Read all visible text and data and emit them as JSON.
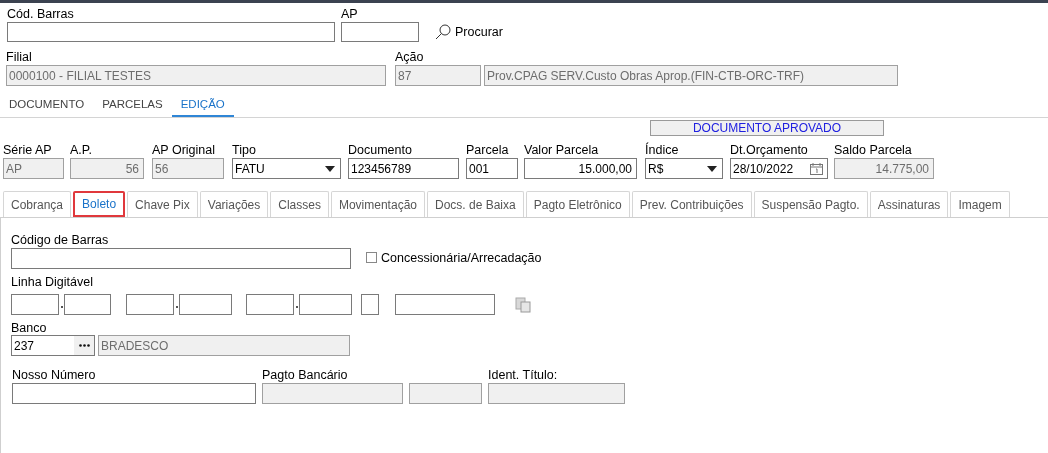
{
  "search": {
    "fields": [
      {
        "label": "Cód. Barras"
      },
      {
        "label": "AP"
      }
    ],
    "button": "Procurar"
  },
  "header": {
    "fields": [
      {
        "label": "Filial",
        "kind": "readonly",
        "value": "0000100 - FILIAL TESTES"
      },
      {
        "label": "Ação",
        "kind": "readonly",
        "value": "87"
      },
      {
        "kind": "readonly",
        "value": "Prov.CPAG SERV.Custo Obras Aprop.(FIN-CTB-ORC-TRF)"
      }
    ]
  },
  "main_tabs": [
    {
      "label": "DOCUMENTO",
      "selected": false
    },
    {
      "label": "PARCELAS",
      "selected": false
    },
    {
      "label": "EDIÇÃO",
      "selected": true
    }
  ],
  "status": "DOCUMENTO APROVADO",
  "fields": [
    {
      "label": "Série AP",
      "kind": "readonly",
      "value": "AP"
    },
    {
      "label": "A.P.",
      "kind": "readonly-amount",
      "value": "56"
    },
    {
      "label": "AP Original",
      "kind": "readonly",
      "value": "56"
    },
    {
      "label": "Tipo",
      "kind": "select",
      "value": "FATU"
    },
    {
      "label": "Documento",
      "kind": "text",
      "value": "123456789"
    },
    {
      "label": "Parcela",
      "kind": "text",
      "value": "001"
    },
    {
      "label": "Valor Parcela",
      "kind": "amount",
      "value": "15.000,00"
    },
    {
      "label": "Índice",
      "kind": "select",
      "value": "R$"
    },
    {
      "label": "Dt.Orçamento",
      "kind": "date",
      "value": "28/10/2022"
    },
    {
      "label": "Saldo Parcela",
      "kind": "readonly-amount",
      "value": "14.775,00"
    }
  ],
  "sub_tabs": [
    {
      "label": "Cobrança",
      "selected": false
    },
    {
      "label": "Boleto",
      "selected": true
    },
    {
      "label": "Chave Pix",
      "selected": false
    },
    {
      "label": "Variações",
      "selected": false
    },
    {
      "label": "Classes",
      "selected": false
    },
    {
      "label": "Movimentação",
      "selected": false
    },
    {
      "label": "Docs. de Baixa",
      "selected": false
    },
    {
      "label": "Pagto Eletrônico",
      "selected": false
    },
    {
      "label": "Prev. Contribuições",
      "selected": false
    },
    {
      "label": "Suspensão Pagto.",
      "selected": false
    },
    {
      "label": "Assinaturas",
      "selected": false
    },
    {
      "label": "Imagem",
      "selected": false
    }
  ],
  "boleto": {
    "barcode": {
      "label": "Código de Barras"
    },
    "checkbox": {
      "label": "Concessionária/Arrecadação",
      "checked": false
    },
    "digitable_line": {
      "label": "Linha Digitável"
    },
    "bank": {
      "label": "Banco",
      "code": "237",
      "name": "BRADESCO"
    },
    "bottom_fields": [
      {
        "label": "Nosso Número"
      },
      {
        "label": "Pagto Bancário",
        "kind": "readonly"
      },
      {
        "kind": "readonly"
      },
      {
        "label": "Ident. Título:",
        "kind": "readonly"
      }
    ]
  }
}
